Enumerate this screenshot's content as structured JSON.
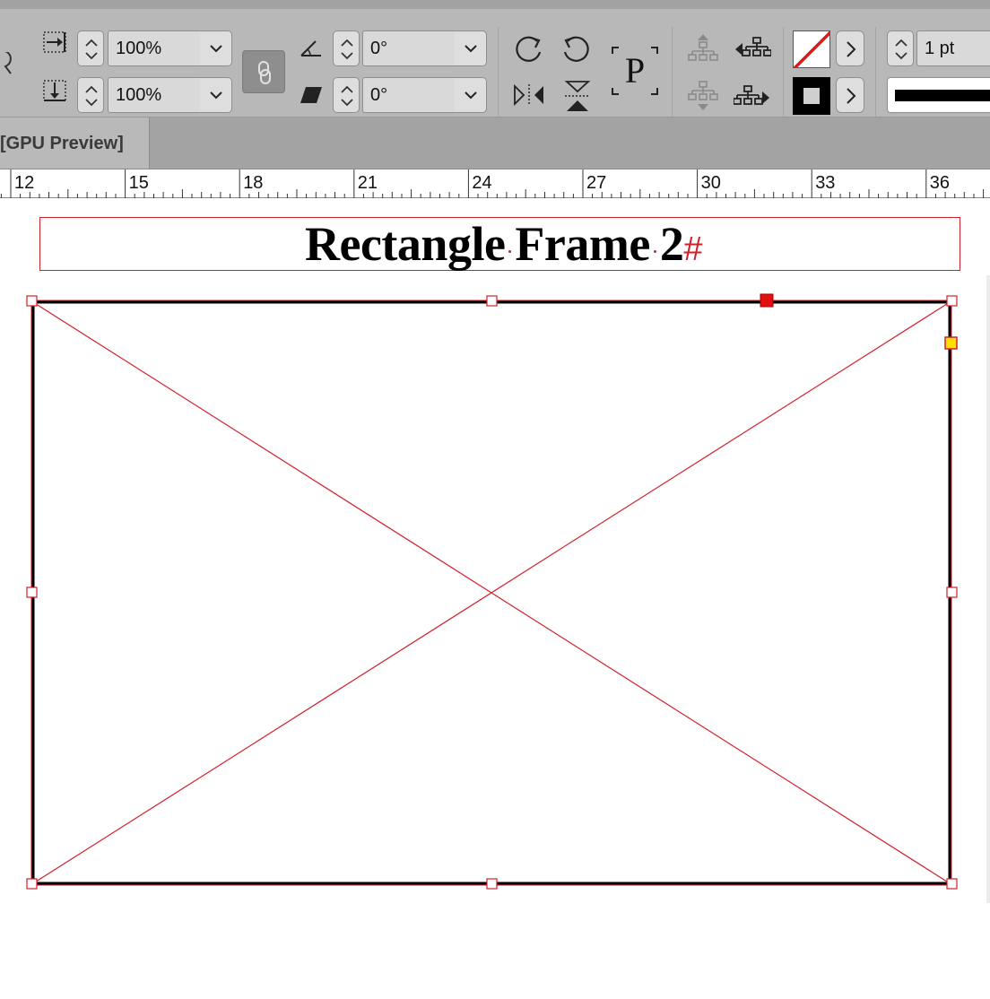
{
  "control_bar": {
    "scale_x": {
      "value": "100%",
      "icon": "scale-x-icon"
    },
    "scale_y": {
      "value": "100%",
      "icon": "scale-y-icon"
    },
    "constrain_proportions": {
      "icon": "link-icon",
      "active": true
    },
    "rotation_angle": {
      "value": "0°",
      "icon": "rotate-angle-icon"
    },
    "shear_angle": {
      "value": "0°",
      "icon": "shear-icon"
    },
    "stroke_weight": {
      "value": "1 pt"
    },
    "fill_color": "none",
    "stroke_color": "#000000",
    "accent_color": "#d2202a"
  },
  "tab_bar": {
    "document_tab_label": "[GPU Preview]"
  },
  "ruler": {
    "labels": [
      "12",
      "15",
      "18",
      "21",
      "24",
      "27",
      "30",
      "33",
      "36"
    ]
  },
  "canvas": {
    "title_text": {
      "word1": "Rectangle",
      "word2": "Frame",
      "word3": "2",
      "end_of_story_mark": "#"
    },
    "placeholder_frame": {
      "type": "rectangle-frame-placeholder",
      "stroke": "#000000",
      "selection_color": "#d2202a"
    }
  }
}
